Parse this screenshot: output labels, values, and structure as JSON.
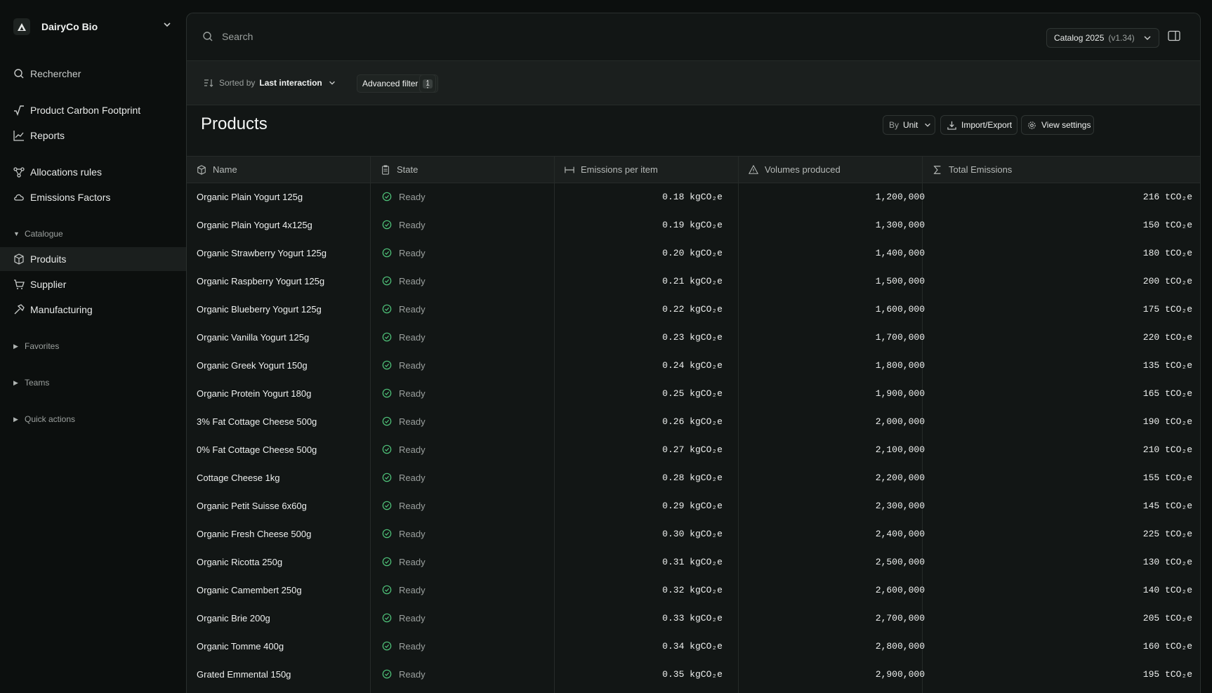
{
  "org": {
    "name": "DairyCo Bio"
  },
  "sidebar": {
    "search_label": "Rechercher",
    "items_top": [
      {
        "label": "Product Carbon Footprint",
        "icon": "sqrt-icon"
      },
      {
        "label": "Reports",
        "icon": "chart-line-icon"
      }
    ],
    "items_mid": [
      {
        "label": "Allocations rules",
        "icon": "share-nodes-icon"
      },
      {
        "label": "Emissions Factors",
        "icon": "cloud-icon"
      }
    ],
    "catalogue": {
      "label": "Catalogue",
      "items": [
        {
          "label": "Produits",
          "icon": "box-icon",
          "active": true
        },
        {
          "label": "Supplier",
          "icon": "cart-icon"
        },
        {
          "label": "Manufacturing",
          "icon": "hammer-icon"
        }
      ]
    },
    "groups": [
      "Favorites",
      "Teams",
      "Quick actions"
    ]
  },
  "topbar": {
    "search_placeholder": "Search",
    "catalog_name": "Catalog 2025",
    "catalog_version": "(v1.34)"
  },
  "filterbar": {
    "sorted_by_label": "Sorted by",
    "sorted_by_value": "Last interaction",
    "advanced_filter_label": "Advanced filter",
    "advanced_filter_count": "1"
  },
  "page": {
    "title": "Products",
    "by_label": "By",
    "by_value": "Unit",
    "import_export_label": "Import/Export",
    "view_settings_label": "View settings"
  },
  "table": {
    "columns": [
      "Name",
      "State",
      "Emissions per item",
      "Volumes produced",
      "Total Emissions"
    ],
    "state_color": "#4fc47a",
    "rows": [
      {
        "name": "Organic Plain Yogurt 125g",
        "state": "Ready",
        "emissions": "0.18 kgCO₂e",
        "volume": "1,200,000",
        "total": "216 tCO₂e"
      },
      {
        "name": "Organic Plain Yogurt 4x125g",
        "state": "Ready",
        "emissions": "0.19 kgCO₂e",
        "volume": "1,300,000",
        "total": "150 tCO₂e"
      },
      {
        "name": "Organic Strawberry Yogurt 125g",
        "state": "Ready",
        "emissions": "0.20 kgCO₂e",
        "volume": "1,400,000",
        "total": "180 tCO₂e"
      },
      {
        "name": "Organic Raspberry Yogurt 125g",
        "state": "Ready",
        "emissions": "0.21 kgCO₂e",
        "volume": "1,500,000",
        "total": "200 tCO₂e"
      },
      {
        "name": "Organic Blueberry Yogurt 125g",
        "state": "Ready",
        "emissions": "0.22 kgCO₂e",
        "volume": "1,600,000",
        "total": "175 tCO₂e"
      },
      {
        "name": "Organic Vanilla Yogurt 125g",
        "state": "Ready",
        "emissions": "0.23 kgCO₂e",
        "volume": "1,700,000",
        "total": "220 tCO₂e"
      },
      {
        "name": "Organic Greek Yogurt 150g",
        "state": "Ready",
        "emissions": "0.24 kgCO₂e",
        "volume": "1,800,000",
        "total": "135 tCO₂e"
      },
      {
        "name": "Organic Protein Yogurt 180g",
        "state": "Ready",
        "emissions": "0.25 kgCO₂e",
        "volume": "1,900,000",
        "total": "165 tCO₂e"
      },
      {
        "name": "3% Fat Cottage Cheese 500g",
        "state": "Ready",
        "emissions": "0.26 kgCO₂e",
        "volume": "2,000,000",
        "total": "190 tCO₂e"
      },
      {
        "name": "0% Fat Cottage Cheese 500g",
        "state": "Ready",
        "emissions": "0.27 kgCO₂e",
        "volume": "2,100,000",
        "total": "210 tCO₂e"
      },
      {
        "name": "Cottage Cheese 1kg",
        "state": "Ready",
        "emissions": "0.28 kgCO₂e",
        "volume": "2,200,000",
        "total": "155 tCO₂e"
      },
      {
        "name": "Organic Petit Suisse 6x60g",
        "state": "Ready",
        "emissions": "0.29 kgCO₂e",
        "volume": "2,300,000",
        "total": "145 tCO₂e"
      },
      {
        "name": "Organic Fresh Cheese 500g",
        "state": "Ready",
        "emissions": "0.30 kgCO₂e",
        "volume": "2,400,000",
        "total": "225 tCO₂e"
      },
      {
        "name": "Organic Ricotta 250g",
        "state": "Ready",
        "emissions": "0.31 kgCO₂e",
        "volume": "2,500,000",
        "total": "130 tCO₂e"
      },
      {
        "name": "Organic Camembert 250g",
        "state": "Ready",
        "emissions": "0.32 kgCO₂e",
        "volume": "2,600,000",
        "total": "140 tCO₂e"
      },
      {
        "name": "Organic Brie 200g",
        "state": "Ready",
        "emissions": "0.33 kgCO₂e",
        "volume": "2,700,000",
        "total": "205 tCO₂e"
      },
      {
        "name": "Organic Tomme 400g",
        "state": "Ready",
        "emissions": "0.34 kgCO₂e",
        "volume": "2,800,000",
        "total": "160 tCO₂e"
      },
      {
        "name": "Grated Emmental 150g",
        "state": "Ready",
        "emissions": "0.35 kgCO₂e",
        "volume": "2,900,000",
        "total": "195 tCO₂e"
      }
    ]
  }
}
